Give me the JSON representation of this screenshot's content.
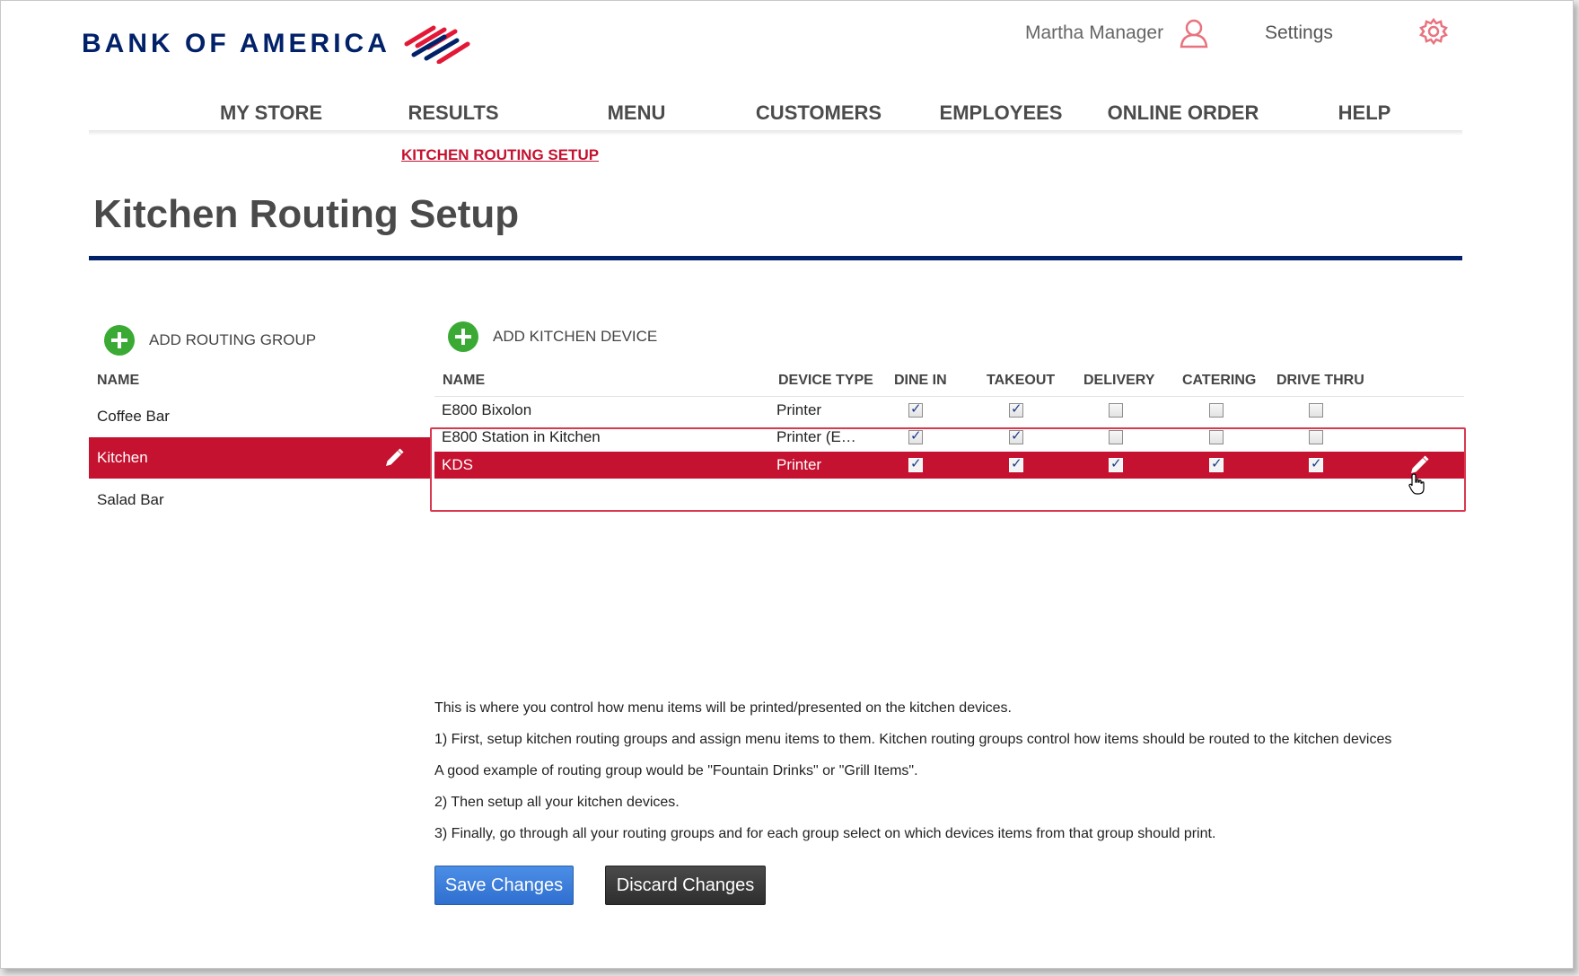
{
  "brand": {
    "name": "BANK OF AMERICA",
    "color": "#012169",
    "flag_red": "#e31837"
  },
  "header": {
    "user_name": "Martha Manager",
    "user_icon": "user-icon",
    "settings_label": "Settings",
    "settings_icon": "gear-icon"
  },
  "nav": {
    "items": [
      "MY STORE",
      "RESULTS",
      "MENU",
      "CUSTOMERS",
      "EMPLOYEES",
      "ONLINE ORDER",
      "HELP"
    ],
    "sub_item": "KITCHEN ROUTING SETUP"
  },
  "page": {
    "title": "Kitchen Routing Setup"
  },
  "routing_groups": {
    "add_label": "ADD ROUTING GROUP",
    "column_header": "NAME",
    "items": [
      {
        "name": "Coffee Bar",
        "selected": false
      },
      {
        "name": "Kitchen",
        "selected": true
      },
      {
        "name": "Salad Bar",
        "selected": false
      }
    ]
  },
  "devices": {
    "add_label": "ADD KITCHEN DEVICE",
    "columns": [
      "NAME",
      "DEVICE TYPE",
      "DINE IN",
      "TAKEOUT",
      "DELIVERY",
      "CATERING",
      "DRIVE THRU"
    ],
    "rows": [
      {
        "name": "E800 Bixolon",
        "type": "Printer",
        "checks": [
          true,
          true,
          false,
          false,
          false
        ],
        "selected": false
      },
      {
        "name": "E800 Station in Kitchen",
        "type": "Printer (E…",
        "checks": [
          true,
          true,
          false,
          false,
          false
        ],
        "selected": false
      },
      {
        "name": "KDS",
        "type": "Printer",
        "checks": [
          true,
          true,
          true,
          true,
          true
        ],
        "selected": true
      }
    ]
  },
  "instructions": [
    "This is where you control how menu items will be printed/presented on the kitchen devices.",
    "1) First, setup kitchen routing groups and assign menu items to them. Kitchen routing groups control how items should be routed to the kitchen devices",
    "A good example of routing group would be \"Fountain Drinks\" or \"Grill Items\".",
    "2) Then setup all your kitchen devices.",
    "3) Finally, go through all your routing groups and for each group select on which devices items from that group should print."
  ],
  "actions": {
    "save_label": "Save Changes",
    "discard_label": "Discard Changes"
  },
  "colors": {
    "accent_red": "#c41230",
    "navy": "#012169",
    "add_green": "#3aaa35",
    "save_blue": "#3a7bd5",
    "discard_dark": "#3a3a3a"
  }
}
